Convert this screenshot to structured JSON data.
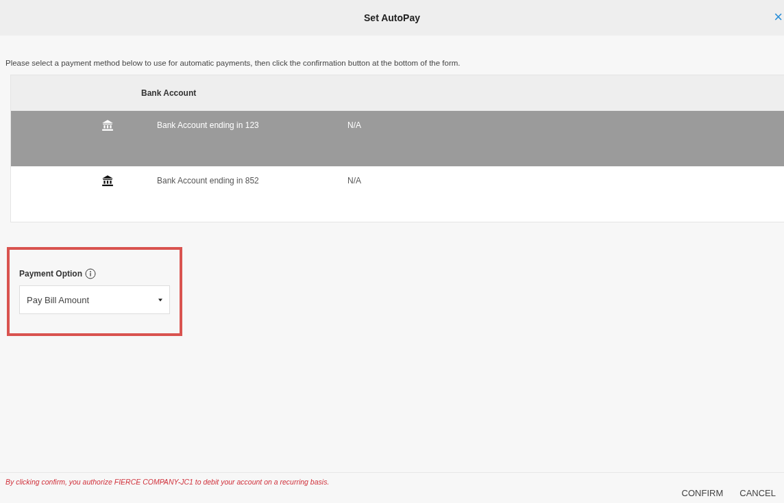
{
  "dialog": {
    "title": "Set AutoPay",
    "close": "×"
  },
  "instructions": "Please select a payment method below to use for automatic payments, then click the confirmation button at the bottom of the form.",
  "accounts": {
    "columns": [
      "Bank Account"
    ],
    "rows": [
      {
        "name": "Bank Account ending in 123",
        "column_3": "N/A",
        "selected": true
      },
      {
        "name": "Bank Account ending in 852",
        "column_3": "N/A",
        "selected": false
      }
    ]
  },
  "payment_option": {
    "label": "Payment Option",
    "value": "Pay Bill Amount",
    "highlighted": true
  },
  "disclaimer": "By clicking confirm, you authorize FIERCE COMPANY-JC1 to debit your account on a recurring basis.",
  "buttons": [
    "CONFIRM",
    "CANCEL"
  ]
}
